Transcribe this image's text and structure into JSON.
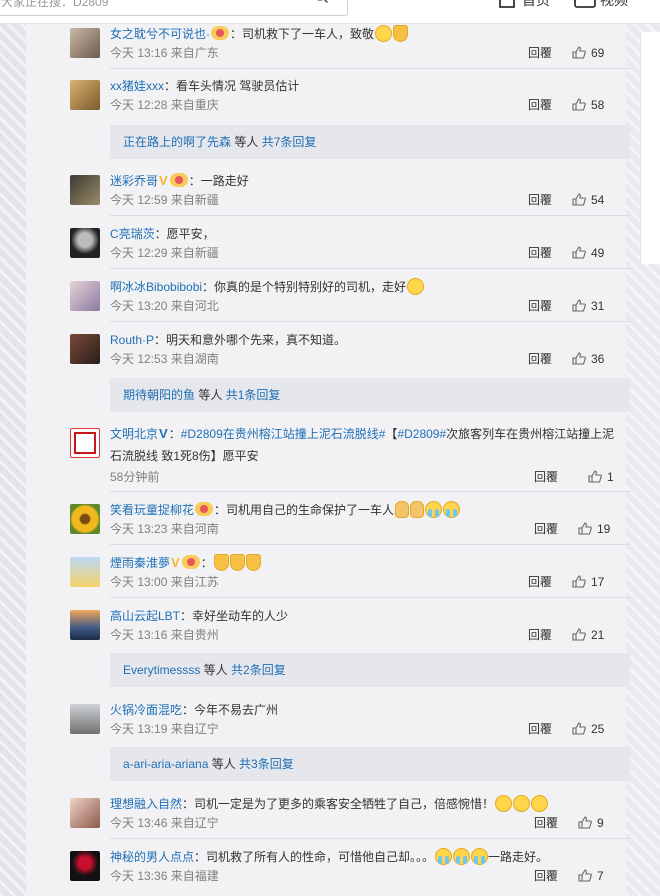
{
  "search": {
    "text": "大家正在搜：D2809"
  },
  "nav": {
    "home_label": "首页",
    "video_label": "视频"
  },
  "reply_label": "回覆",
  "colors": {
    "username": "#eb7350",
    "link": "#1f6fb5",
    "meta": "#808080"
  },
  "comments": [
    {
      "user": "女之耽兮不可说也·",
      "text": "：司机救下了一车人，致敬",
      "time": "今天 13:16 来自广东",
      "likes": "69"
    },
    {
      "user": "xx猪娃xxx",
      "text": "：看车头情况 驾驶员估计",
      "time": "今天 12:28 来自重庆",
      "likes": "58"
    },
    {
      "user": "迷彩乔哥",
      "text": "：一路走好",
      "time": "今天 12:59 来自新疆",
      "likes": "54"
    },
    {
      "user": "C亮瑞茨",
      "text": "：愿平安，",
      "time": "今天 12:29 来自新疆",
      "likes": "49"
    },
    {
      "user": "啊冰冰Bibobibobi",
      "text": "：你真的是个特别特别好的司机，走好",
      "time": "今天 13:20 来自河北",
      "likes": "31"
    },
    {
      "user": "Routh·P",
      "text": "：明天和意外哪个先来，真不知道。",
      "time": "今天 12:53 来自湖南",
      "likes": "36"
    },
    {
      "user": "文明北京",
      "text_hashtag": "#D2809在贵州榕江站撞上泥石流脱线#",
      "text_bracket": "【",
      "text_hashtag2": "#D2809#",
      "text_line1_rest": "次旅客列车在贵州榕江站撞上泥",
      "text_line2": "石流脱线 致1死8伤】愿平安",
      "time": "58分钟前",
      "likes": "1"
    },
    {
      "user": "笑看玩童捉柳花",
      "text": "：司机用自己的生命保护了一车人",
      "time": "今天 13:23 来自河南",
      "likes": "19"
    },
    {
      "user": "煙雨秦淮夢",
      "text": "：",
      "time": "今天 13:00 来自江苏",
      "likes": "17"
    },
    {
      "user": "高山云起LBT",
      "text": "：幸好坐动车的人少",
      "time": "今天 13:16 来自贵州",
      "likes": "21"
    },
    {
      "user": "火锅冷面混吃",
      "text": "：今年不易去广州",
      "time": "今天 13:19 来自辽宁",
      "likes": "25"
    },
    {
      "user": "理想融入自然",
      "text": "：司机一定是为了更多的乘客安全牺牲了自己，倍感惋惜！",
      "time": "今天 13:46 来自辽宁",
      "likes": "9"
    },
    {
      "user": "神秘的男人点点",
      "text": "：司机救了所有人的性命，可惜他自己却。。。",
      "text_tail": "一路走好。",
      "time": "今天 13:36 来自福建",
      "likes": "7"
    }
  ],
  "subreplies": [
    {
      "who": "正在路上的啊了先森",
      "etc": " 等人 ",
      "total": "共7条回复"
    },
    {
      "who": "期待朝阳的鱼",
      "etc": " 等人 ",
      "total": "共1条回复"
    },
    {
      "who": "Everytimessss",
      "etc": " 等人 ",
      "total": "共2条回复"
    },
    {
      "who": "a-ari-aria-ariana",
      "etc": " 等人 ",
      "total": "共3条回复"
    }
  ],
  "icons": {
    "search": "search-icon",
    "home": "home-icon",
    "video": "video-icon",
    "like": "thumbs-up-icon",
    "verified": "verified-v-icon",
    "member": "member-badge-icon"
  }
}
